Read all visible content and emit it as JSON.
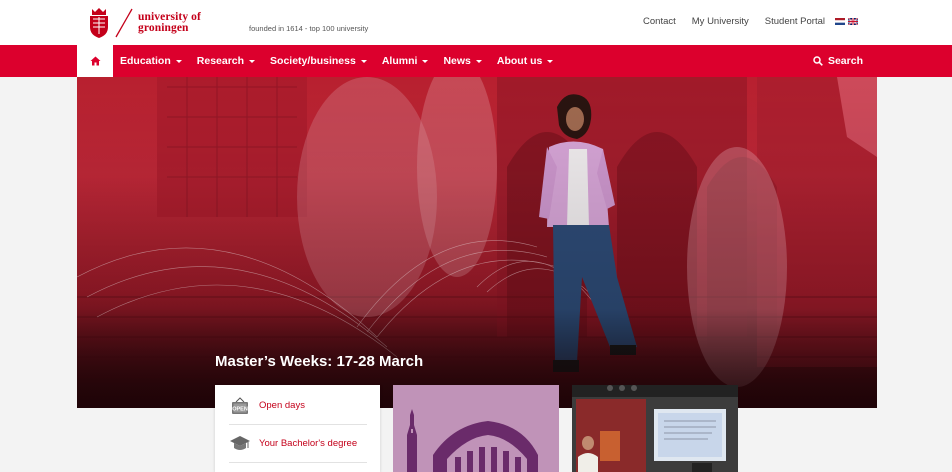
{
  "brand": {
    "logo_line1": "university of",
    "logo_line2": "groningen",
    "tagline": "founded in 1614  -  top 100 university",
    "accent_color": "#dc002d"
  },
  "top_links": [
    "Contact",
    "My University",
    "Student Portal"
  ],
  "languages": [
    "nl-flag-icon",
    "uk-flag-icon"
  ],
  "nav": {
    "home_icon": "home-icon",
    "items": [
      "Education",
      "Research",
      "Society/business",
      "Alumni",
      "News",
      "About us"
    ],
    "search_label": "Search",
    "search_icon": "search-icon"
  },
  "hero": {
    "title": "Master’s Weeks: 17-28 March"
  },
  "quick_links": [
    {
      "label": "Open days",
      "icon": "open-sign-icon"
    },
    {
      "label": "Your Bachelor's degree",
      "icon": "graduation-cap-icon"
    }
  ]
}
